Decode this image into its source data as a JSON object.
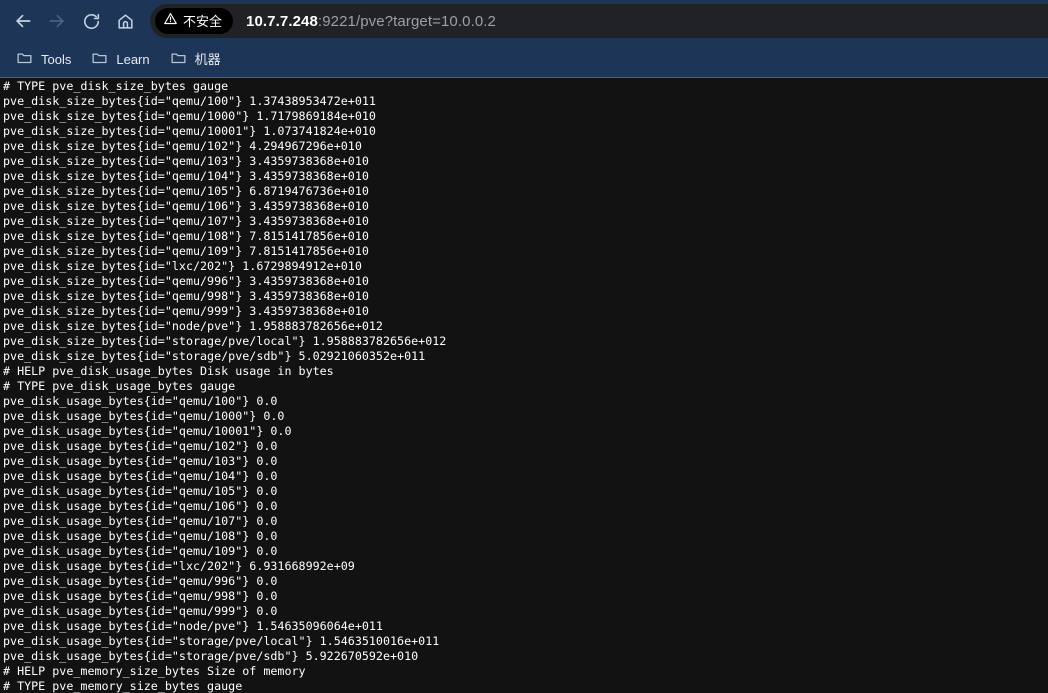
{
  "browser": {
    "nav": {
      "back": {
        "icon": "back-arrow-icon",
        "label": "Back",
        "enabled": true
      },
      "forward": {
        "icon": "forward-arrow-icon",
        "label": "Forward",
        "enabled": false
      },
      "reload": {
        "icon": "reload-icon",
        "label": "Reload"
      },
      "home": {
        "icon": "home-icon",
        "label": "Home"
      }
    },
    "omnibox": {
      "security_badge": {
        "icon": "warning-triangle-icon",
        "label": "不安全"
      },
      "url_host": "10.7.7.248",
      "url_rest": ":9221/pve?target=10.0.0.2",
      "full_url": "10.7.7.248:9221/pve?target=10.0.0.2"
    },
    "bookmarks": [
      {
        "icon": "folder-icon",
        "label": "Tools"
      },
      {
        "icon": "folder-icon",
        "label": "Learn"
      },
      {
        "icon": "folder-icon",
        "label": "机器"
      }
    ]
  },
  "colors": {
    "chrome_bg": "#1d3557",
    "omnibox_bg": "#212226",
    "chip_bg": "#000000",
    "page_bg": "#121212",
    "page_fg": "#ffffff",
    "url_dim": "#9aa0a6"
  },
  "page": {
    "content_type": "prometheus-metrics-exposition",
    "text": "# TYPE pve_disk_size_bytes gauge\npve_disk_size_bytes{id=\"qemu/100\"} 1.37438953472e+011\npve_disk_size_bytes{id=\"qemu/1000\"} 1.7179869184e+010\npve_disk_size_bytes{id=\"qemu/10001\"} 1.073741824e+010\npve_disk_size_bytes{id=\"qemu/102\"} 4.294967296e+010\npve_disk_size_bytes{id=\"qemu/103\"} 3.4359738368e+010\npve_disk_size_bytes{id=\"qemu/104\"} 3.4359738368e+010\npve_disk_size_bytes{id=\"qemu/105\"} 6.8719476736e+010\npve_disk_size_bytes{id=\"qemu/106\"} 3.4359738368e+010\npve_disk_size_bytes{id=\"qemu/107\"} 3.4359738368e+010\npve_disk_size_bytes{id=\"qemu/108\"} 7.8151417856e+010\npve_disk_size_bytes{id=\"qemu/109\"} 7.8151417856e+010\npve_disk_size_bytes{id=\"lxc/202\"} 1.6729894912e+010\npve_disk_size_bytes{id=\"qemu/996\"} 3.4359738368e+010\npve_disk_size_bytes{id=\"qemu/998\"} 3.4359738368e+010\npve_disk_size_bytes{id=\"qemu/999\"} 3.4359738368e+010\npve_disk_size_bytes{id=\"node/pve\"} 1.958883782656e+012\npve_disk_size_bytes{id=\"storage/pve/local\"} 1.958883782656e+012\npve_disk_size_bytes{id=\"storage/pve/sdb\"} 5.02921060352e+011\n# HELP pve_disk_usage_bytes Disk usage in bytes\n# TYPE pve_disk_usage_bytes gauge\npve_disk_usage_bytes{id=\"qemu/100\"} 0.0\npve_disk_usage_bytes{id=\"qemu/1000\"} 0.0\npve_disk_usage_bytes{id=\"qemu/10001\"} 0.0\npve_disk_usage_bytes{id=\"qemu/102\"} 0.0\npve_disk_usage_bytes{id=\"qemu/103\"} 0.0\npve_disk_usage_bytes{id=\"qemu/104\"} 0.0\npve_disk_usage_bytes{id=\"qemu/105\"} 0.0\npve_disk_usage_bytes{id=\"qemu/106\"} 0.0\npve_disk_usage_bytes{id=\"qemu/107\"} 0.0\npve_disk_usage_bytes{id=\"qemu/108\"} 0.0\npve_disk_usage_bytes{id=\"qemu/109\"} 0.0\npve_disk_usage_bytes{id=\"lxc/202\"} 6.931668992e+09\npve_disk_usage_bytes{id=\"qemu/996\"} 0.0\npve_disk_usage_bytes{id=\"qemu/998\"} 0.0\npve_disk_usage_bytes{id=\"qemu/999\"} 0.0\npve_disk_usage_bytes{id=\"node/pve\"} 1.54635096064e+011\npve_disk_usage_bytes{id=\"storage/pve/local\"} 1.5463510016e+011\npve_disk_usage_bytes{id=\"storage/pve/sdb\"} 5.922670592e+010\n# HELP pve_memory_size_bytes Size of memory\n# TYPE pve_memory_size_bytes gauge"
  }
}
